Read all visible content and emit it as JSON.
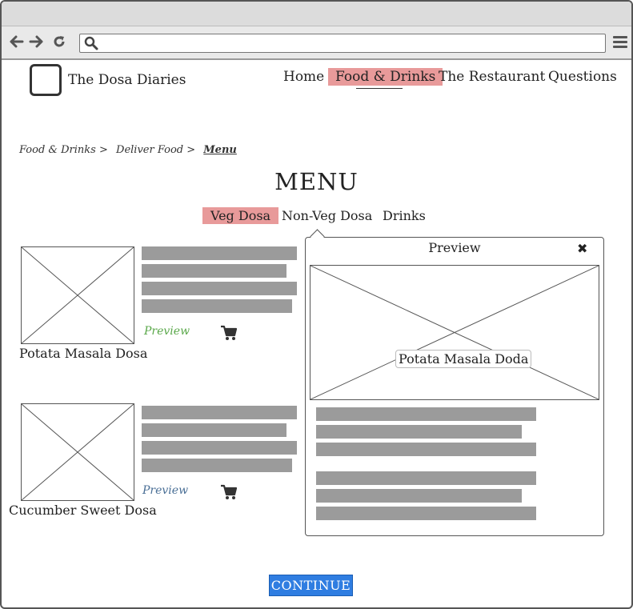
{
  "header": {
    "site_title": "The Dosa Diaries",
    "nav": [
      {
        "label": "Home",
        "active": false
      },
      {
        "label": "Food & Drinks",
        "active": true
      },
      {
        "label": "The Restaurant",
        "active": false
      },
      {
        "label": "Questions",
        "active": false
      }
    ]
  },
  "breadcrumb": [
    "Food & Drinks >",
    "Deliver Food >",
    "Menu"
  ],
  "page_title": "MENU",
  "tabs": [
    {
      "label": "Veg Dosa",
      "active": true
    },
    {
      "label": "Non-Veg Dosa",
      "active": false
    },
    {
      "label": "Drinks",
      "active": false
    }
  ],
  "items": [
    {
      "name": "Potata Masala Dosa",
      "preview_label": "Preview",
      "preview_color": "#5aa84a"
    },
    {
      "name": "Cucumber Sweet Dosa",
      "preview_label": "Preview",
      "preview_color": "#4a6f96"
    }
  ],
  "popup": {
    "title": "Preview",
    "close_icon": "close-icon",
    "image_caption": "Potata Masala Doda"
  },
  "continue_label": "CONTINUE",
  "colors": {
    "highlight": "#e89a9a",
    "button": "#2f7de1",
    "placeholder_line": "#9b9b9b"
  }
}
